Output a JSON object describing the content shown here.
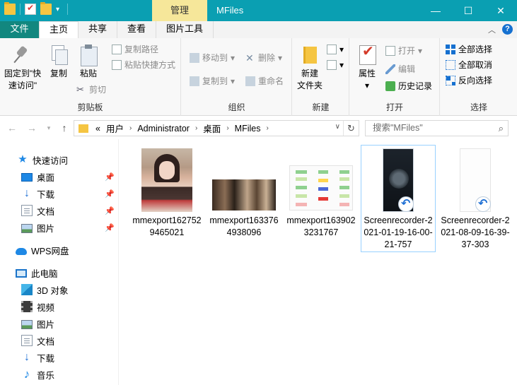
{
  "window": {
    "title": "MFiles",
    "context_tab": "管理",
    "buttons": {
      "minimize": "—",
      "maximize": "☐",
      "close": "✕"
    }
  },
  "ribbon_tabs": [
    "文件",
    "主页",
    "共享",
    "查看",
    "图片工具"
  ],
  "ribbon": {
    "clipboard": {
      "label": "剪贴板",
      "pin_line1": "固定到\"快",
      "pin_line2": "速访问\"",
      "copy": "复制",
      "paste": "粘贴",
      "copy_path": "复制路径",
      "paste_shortcut": "粘贴快捷方式",
      "cut": "剪切"
    },
    "organize": {
      "label": "组织",
      "move_to": "移动到",
      "copy_to": "复制到",
      "delete": "删除",
      "rename": "重命名"
    },
    "new": {
      "label": "新建",
      "new_folder_line1": "新建",
      "new_folder_line2": "文件夹"
    },
    "open": {
      "label": "打开",
      "properties": "属性",
      "open": "打开",
      "edit": "编辑",
      "history": "历史记录"
    },
    "select": {
      "label": "选择",
      "select_all": "全部选择",
      "select_none": "全部取消",
      "invert": "反向选择"
    }
  },
  "address": {
    "overflow": "«",
    "crumbs": [
      "用户",
      "Administrator",
      "桌面",
      "MFiles"
    ],
    "separator": "›"
  },
  "search": {
    "placeholder": "搜索\"MFiles\""
  },
  "nav_pane": {
    "quick_access": "快速访问",
    "quick_items": [
      "桌面",
      "下载",
      "文档",
      "图片"
    ],
    "wps": "WPS网盘",
    "this_pc": "此电脑",
    "pc_items": [
      "3D 对象",
      "视频",
      "图片",
      "文档",
      "下载",
      "音乐"
    ]
  },
  "files": [
    {
      "name": "mmexport1627529465021",
      "thumb": "portrait-photo"
    },
    {
      "name": "mmexport1633764938096",
      "thumb": "crowd-photo"
    },
    {
      "name": "mmexport1639023231767",
      "thumb": "flowchart-image"
    },
    {
      "name": "Screenrecorder-2021-01-19-16-00-21-757",
      "thumb": "dark-phone-screen",
      "selected": true
    },
    {
      "name": "Screenrecorder-2021-08-09-16-39-37-303",
      "thumb": "white-phone-screen"
    }
  ],
  "colors": {
    "titlebar": "#0a9fb2",
    "file_tab": "#12877f",
    "manage_tab": "#f6e79a",
    "selection_border": "#99d1ff",
    "accent_blue": "#1e88e5"
  }
}
